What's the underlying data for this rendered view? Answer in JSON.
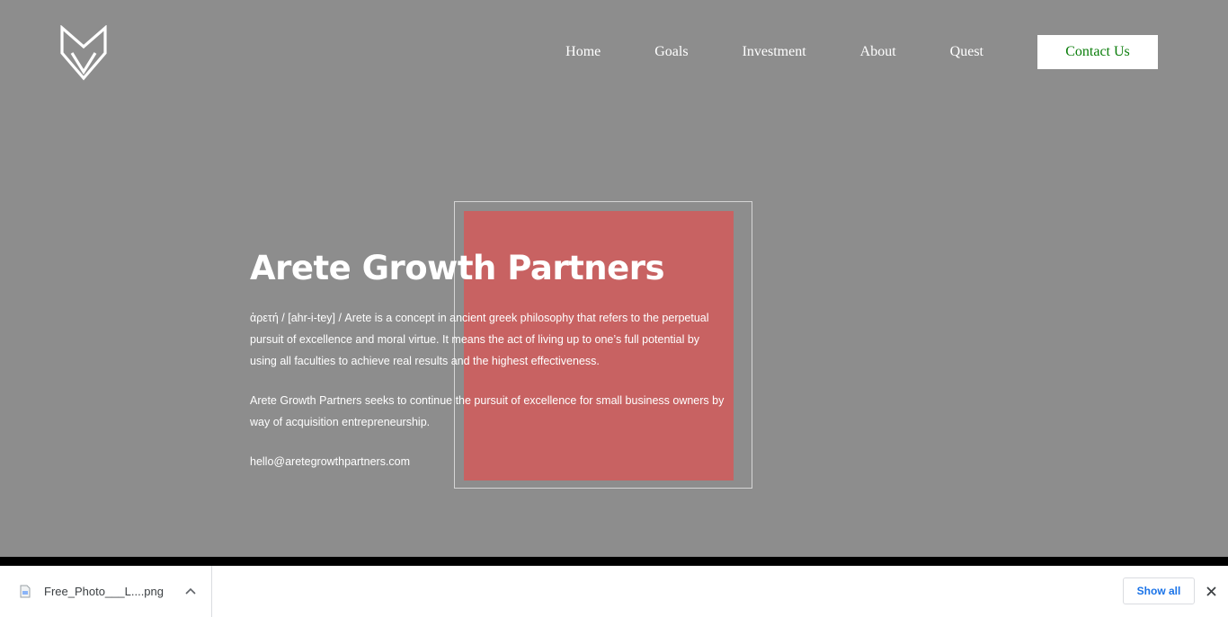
{
  "header": {
    "logo_icon": "fox-logo-icon",
    "nav": [
      "Home",
      "Goals",
      "Investment",
      "About",
      "Quest"
    ],
    "contact_label": "Contact Us"
  },
  "hero": {
    "title": "Arete Growth Partners",
    "paragraph1": "ἀρετή / [ahr-i-tey] / Arete is a concept in ancient greek philosophy that refers to the perpetual pursuit of excellence and moral virtue. It means the act of living up to one’s full potential by using all faculties to achieve real results and the highest effectiveness.",
    "paragraph2": "Arete Growth Partners seeks to continue the pursuit of excellence for small business owners by way of acquisition entrepreneurship.",
    "email": "hello@aretegrowthpartners.com"
  },
  "colors": {
    "background": "#8d8d8d",
    "accent_square": "#c86262",
    "contact_text": "#0a7d0a",
    "show_all_text": "#1a73e8"
  },
  "download_shelf": {
    "file_name": "Free_Photo___L....png",
    "file_icon": "image-file-icon",
    "menu_icon": "chevron-up-icon",
    "show_all_label": "Show all",
    "close_icon": "close-icon"
  }
}
